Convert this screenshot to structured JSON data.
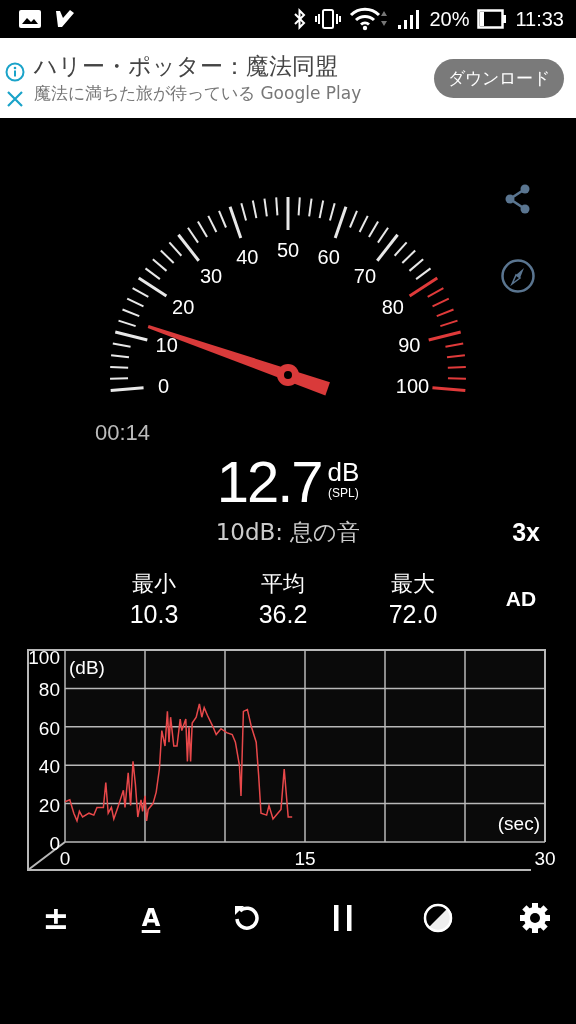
{
  "status_bar": {
    "battery": "20%",
    "time": "11:33"
  },
  "ad": {
    "title": "ハリー・ポッター：魔法同盟",
    "subtitle": "魔法に満ちた旅が待っている Google Play",
    "button": "ダウンロード"
  },
  "gauge": {
    "labels": [
      "0",
      "10",
      "20",
      "30",
      "40",
      "50",
      "60",
      "70",
      "80",
      "90",
      "100"
    ],
    "elapsed": "00:14"
  },
  "reading": {
    "value": "12.7",
    "unit": "dB",
    "weighting": "(SPL)",
    "description": "10dB: 息の音",
    "speed": "3x"
  },
  "stats": [
    {
      "label": "最小",
      "value": "10.3"
    },
    {
      "label": "平均",
      "value": "36.2"
    },
    {
      "label": "最大",
      "value": "72.0"
    }
  ],
  "mode": "AD",
  "chart_data": {
    "type": "line",
    "xlabel": "(sec)",
    "ylabel": "(dB)",
    "xlim": [
      0,
      30
    ],
    "ylim": [
      0,
      100
    ],
    "xticks": [
      0,
      15,
      30
    ],
    "yticks": [
      0,
      20,
      40,
      60,
      80,
      100
    ],
    "grid": true,
    "x": [
      0,
      0.3,
      0.55,
      0.75,
      0.9,
      1.1,
      1.5,
      1.8,
      2.0,
      2.4,
      2.55,
      2.7,
      2.9,
      3.05,
      3.3,
      3.65,
      3.75,
      3.95,
      4.1,
      4.25,
      4.4,
      4.55,
      4.75,
      4.85,
      5.0,
      5.1,
      5.2,
      5.5,
      5.7,
      5.9,
      6.05,
      6.25,
      6.4,
      6.5,
      6.6,
      6.8,
      7.0,
      7.2,
      7.3,
      7.55,
      7.65,
      7.75,
      7.85,
      7.95,
      8.2,
      8.4,
      8.55,
      8.7,
      8.9,
      9.25,
      9.45,
      9.75,
      10.1,
      10.45,
      10.65,
      10.9,
      11.0,
      11.15,
      11.4,
      11.65,
      11.95,
      12.1,
      12.25,
      12.6,
      12.75,
      13.0,
      13.3,
      13.5,
      13.7,
      13.95,
      14.2
    ],
    "series": [
      {
        "color": "#e8484a",
        "values": [
          21,
          22,
          15,
          11,
          16,
          13,
          15,
          14,
          18,
          18,
          31,
          15,
          18,
          12,
          18,
          27,
          18,
          36,
          19,
          42,
          30,
          13,
          22,
          16,
          24,
          11,
          17,
          20,
          26,
          38,
          58,
          50,
          68,
          52,
          65,
          50,
          50,
          64,
          58,
          64,
          42,
          60,
          42,
          62,
          65,
          72,
          65,
          70,
          66,
          60,
          56,
          59,
          57,
          56,
          52,
          40,
          24,
          68,
          69,
          60,
          52,
          35,
          15,
          14,
          19,
          12,
          15,
          17,
          38,
          13,
          13
        ]
      }
    ]
  },
  "toolbar": [
    {
      "kind": "plus-minus",
      "glyph": "±"
    },
    {
      "kind": "font",
      "glyph": "A"
    },
    {
      "kind": "reset"
    },
    {
      "kind": "pause"
    },
    {
      "kind": "contrast"
    },
    {
      "kind": "settings"
    }
  ]
}
